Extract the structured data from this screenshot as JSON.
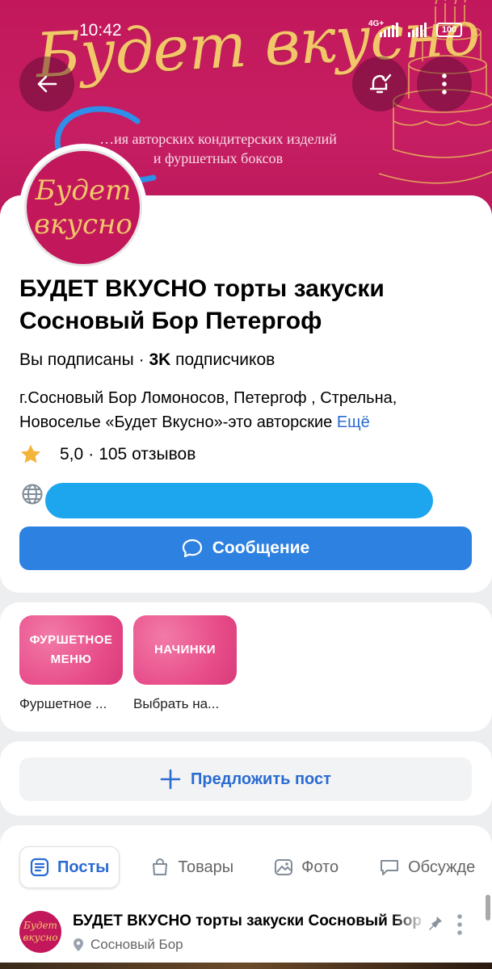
{
  "status_bar": {
    "time": "10:42",
    "network": "4G+",
    "battery": "100"
  },
  "cover": {
    "brand_text": "Будет вкусно",
    "tagline_line1": "…ия авторских кондитерских изделий",
    "tagline_line2": "и фуршетных боксов",
    "background_color": "#c2185b",
    "brand_color": "#f1c76a"
  },
  "top_actions": {
    "back_icon": "arrow-left-icon",
    "subscribe_icon": "bell-check-icon",
    "more_icon": "more-vertical-icon"
  },
  "avatar": {
    "line1": "Будет",
    "line2": "вкусно"
  },
  "community": {
    "title": "БУДЕТ ВКУСНО торты закуски Сосновый Бор Петергоф",
    "subscribed": "Вы подписаны",
    "separator": "·",
    "subscriber_count": "3K",
    "subscribers_label": "подписчиков",
    "description": "г.Сосновый Бор Ломоносов, Петергоф , Стрельна, Новоселье «Будет Вкусно»-это авторские",
    "more_link": "Ещё",
    "rating": "5,0",
    "reviews": "105 отзывов",
    "rating_separator": "·",
    "message_button": "Сообщение",
    "accent_color": "#2d81e0"
  },
  "highlights": [
    {
      "tile_line1": "ФУРШЕТНОЕ",
      "tile_line2": "МЕНЮ",
      "caption": "Фуршетное ..."
    },
    {
      "tile_line1": "НАЧИНКИ",
      "tile_line2": "",
      "caption": "Выбрать на..."
    }
  ],
  "propose": {
    "label": "Предложить пост"
  },
  "tabs": [
    {
      "label": "Посты",
      "icon": "posts-icon",
      "active": true
    },
    {
      "label": "Товары",
      "icon": "bag-icon",
      "active": false
    },
    {
      "label": "Фото",
      "icon": "photo-icon",
      "active": false
    },
    {
      "label": "Обсужде",
      "icon": "chat-icon",
      "active": false
    }
  ],
  "post": {
    "author": "БУДЕТ ВКУСНО торты закуски Сосновый Бор Петергоф",
    "location": "Сосновый Бор",
    "avatar_line1": "Будет",
    "avatar_line2": "вкусно"
  }
}
